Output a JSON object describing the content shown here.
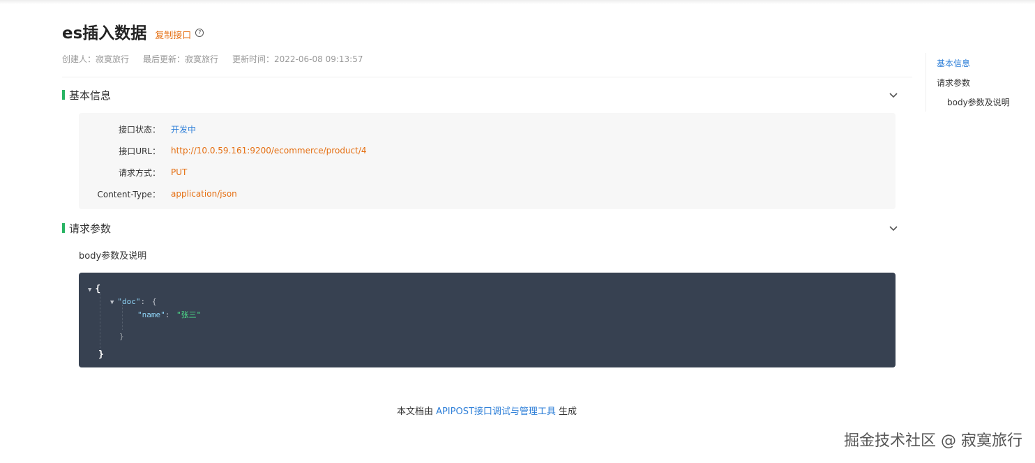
{
  "header": {
    "title": "es插入数据",
    "copy_label": "复制接口",
    "help_icon": "question-circle-icon"
  },
  "meta": {
    "creator": "创建人：寂寞旅行",
    "last_update": "最后更新：寂寞旅行",
    "update_time": "更新时间：2022-06-08 09:13:57"
  },
  "sections": {
    "basic_info": "基本信息",
    "request_params": "请求参数"
  },
  "info": {
    "status_label": "接口状态：",
    "status_value": "开发中",
    "url_label": "接口URL：",
    "url_value": "http://10.0.59.161:9200/ecommerce/product/4",
    "method_label": "请求方式：",
    "method_value": "PUT",
    "content_type_label": "Content-Type：",
    "content_type_value": "application/json"
  },
  "body": {
    "title": "body参数及说明",
    "code": {
      "open_brace": "{",
      "doc_key": "\"doc\"",
      "colon": ":",
      "doc_open": "{",
      "name_key": "\"name\"",
      "name_value": "\"张三\"",
      "doc_close": "}",
      "close_brace": "}"
    }
  },
  "sidenav": {
    "items": [
      "基本信息",
      "请求参数",
      "body参数及说明"
    ]
  },
  "footer": {
    "prefix": "本文档由 ",
    "link": "APIPOST接口调试与管理工具",
    "suffix": " 生成"
  },
  "watermark": "掘金技术社区 @ 寂寞旅行",
  "colors": {
    "accent_green": "#28b463",
    "link_blue": "#2e7fd8",
    "value_orange": "#e56f12",
    "code_bg": "#374151"
  }
}
